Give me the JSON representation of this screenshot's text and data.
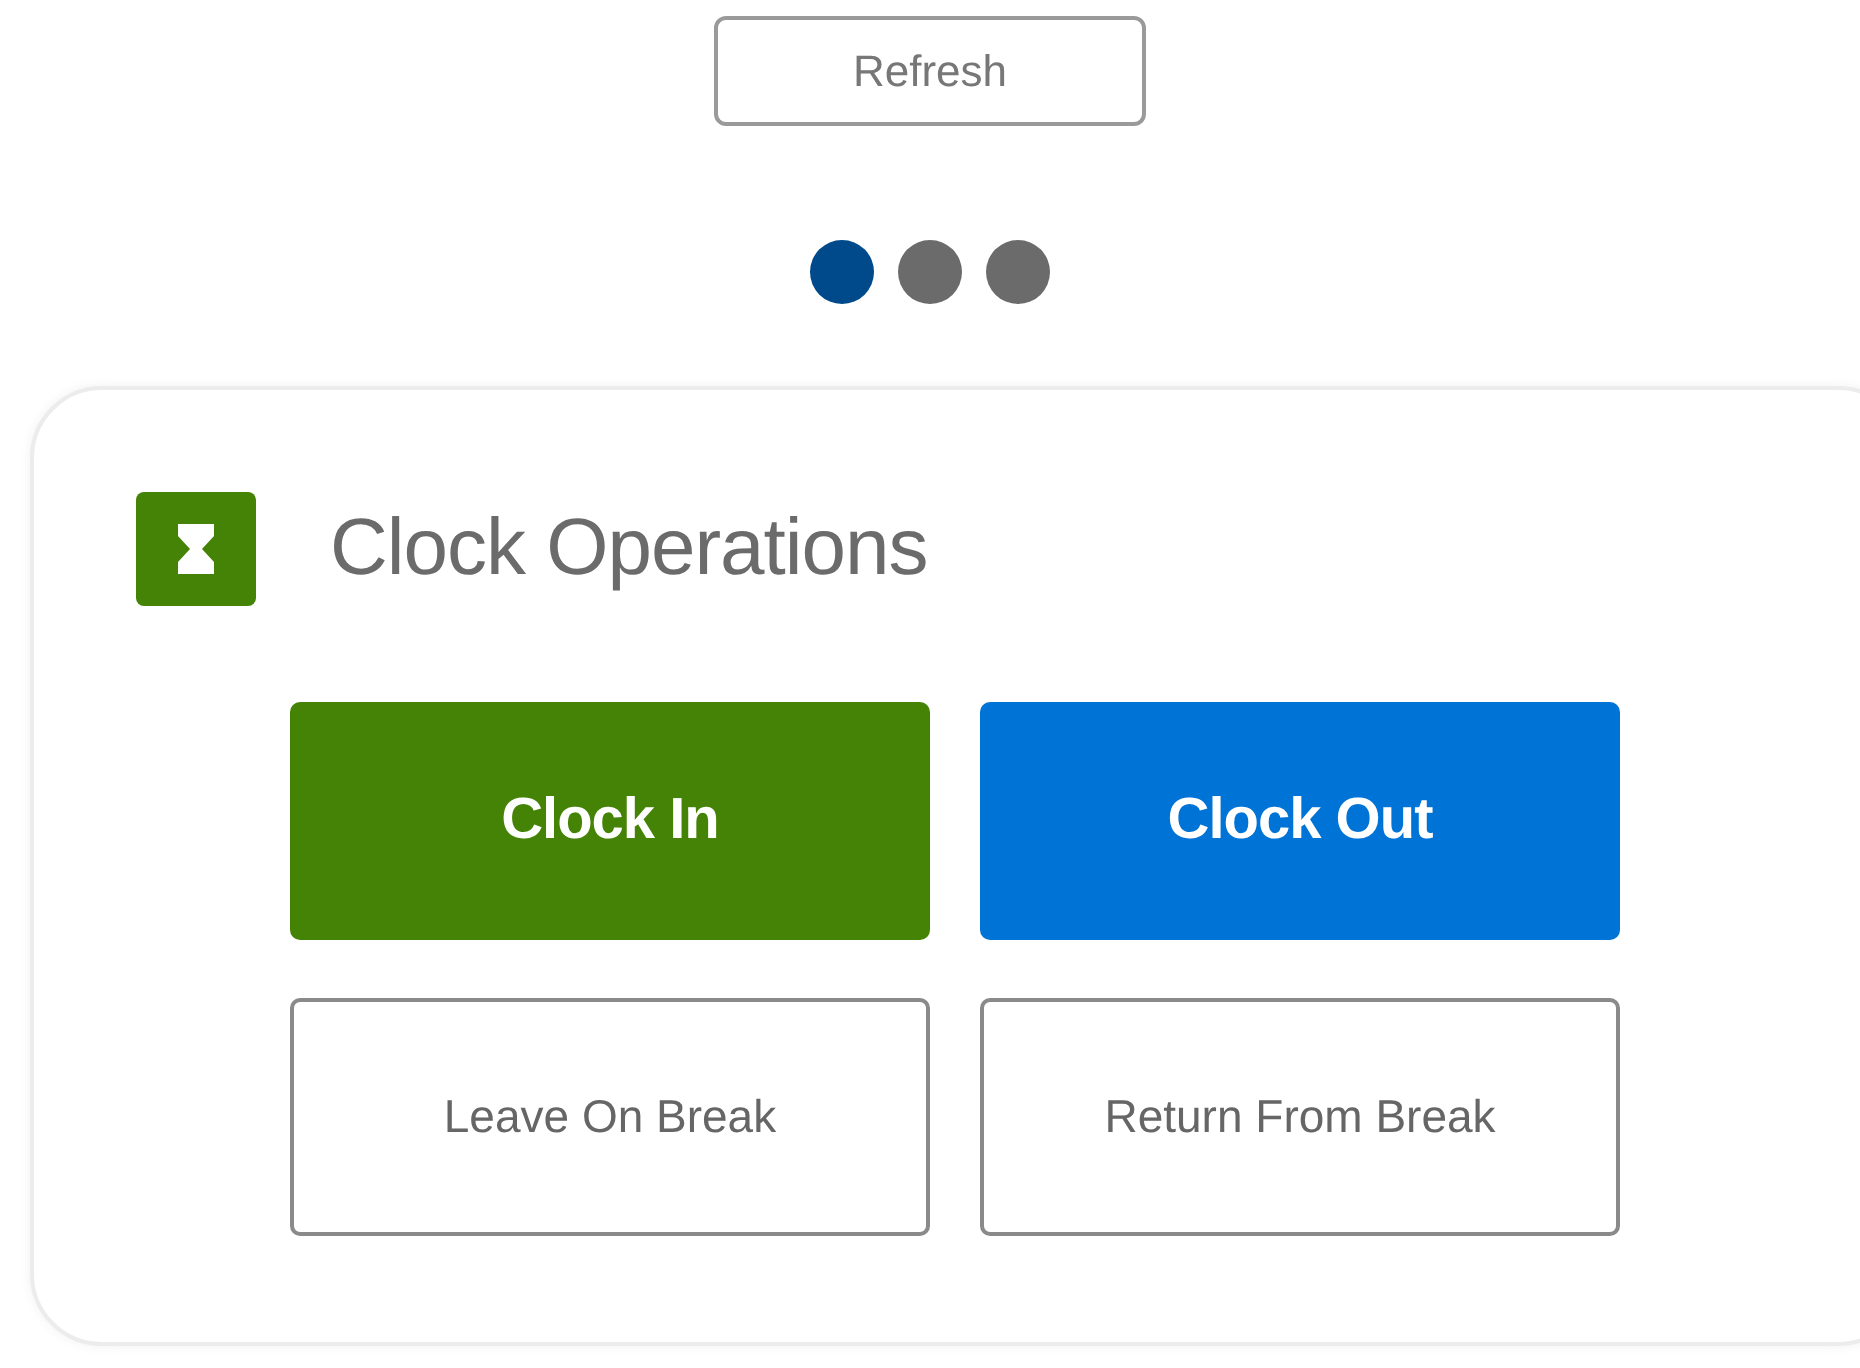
{
  "refresh_button": {
    "label": "Refresh"
  },
  "pager_dots": [
    {
      "selected": true
    },
    {
      "selected": false
    },
    {
      "selected": false
    }
  ],
  "card": {
    "title": "Clock Operations",
    "buttons": [
      {
        "label": "Clock In",
        "kind": "filled",
        "color": "#448305"
      },
      {
        "label": "Clock Out",
        "kind": "filled",
        "color": "#0073d6"
      },
      {
        "label": "Leave On Break",
        "kind": "outline"
      },
      {
        "label": "Return From Break",
        "kind": "outline"
      }
    ]
  }
}
